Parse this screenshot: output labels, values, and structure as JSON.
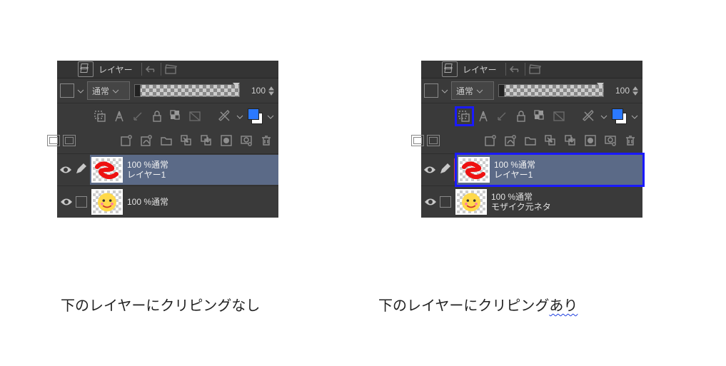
{
  "shared": {
    "panel_title": "レイヤー",
    "blend_mode": "通常",
    "opacity_value": "100"
  },
  "panels": {
    "left": {
      "layers": [
        {
          "line1": "100 %通常",
          "line2": "レイヤー1"
        },
        {
          "line1": "100 %通常",
          "line2": ""
        }
      ]
    },
    "right": {
      "layers": [
        {
          "line1": "100 %通常",
          "line2": "レイヤー1"
        },
        {
          "line1": "100 %通常",
          "line2": "モザイク元ネタ"
        }
      ]
    }
  },
  "captions": {
    "left": "下のレイヤーにクリピングなし",
    "right_prefix": "下のレイヤーにクリピング",
    "right_wavy": "あり"
  }
}
